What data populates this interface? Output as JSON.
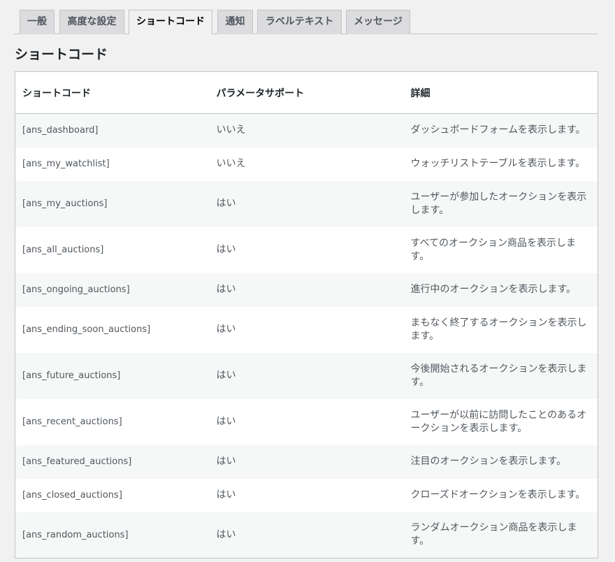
{
  "tabs": [
    {
      "label": "一般",
      "active": false
    },
    {
      "label": "高度な設定",
      "active": false
    },
    {
      "label": "ショートコード",
      "active": true
    },
    {
      "label": "通知",
      "active": false
    },
    {
      "label": "ラベルテキスト",
      "active": false
    },
    {
      "label": "メッセージ",
      "active": false
    }
  ],
  "section_title": "ショートコード",
  "table": {
    "headers": [
      "ショートコード",
      "パラメータサポート",
      "詳細"
    ],
    "rows": [
      {
        "code": "[ans_dashboard]",
        "param": "いいえ",
        "desc": "ダッシュボードフォームを表示します。"
      },
      {
        "code": "[ans_my_watchlist]",
        "param": "いいえ",
        "desc": "ウォッチリストテーブルを表示します。"
      },
      {
        "code": "[ans_my_auctions]",
        "param": "はい",
        "desc": "ユーザーが参加したオークションを表示します。"
      },
      {
        "code": "[ans_all_auctions]",
        "param": "はい",
        "desc": "すべてのオークション商品を表示します。"
      },
      {
        "code": "[ans_ongoing_auctions]",
        "param": "はい",
        "desc": "進行中のオークションを表示します。"
      },
      {
        "code": "[ans_ending_soon_auctions]",
        "param": "はい",
        "desc": "まもなく終了するオークションを表示します。"
      },
      {
        "code": "[ans_future_auctions]",
        "param": "はい",
        "desc": "今後開始されるオークションを表示します。"
      },
      {
        "code": "[ans_recent_auctions]",
        "param": "はい",
        "desc": "ユーザーが以前に訪問したことのあるオークションを表示します。"
      },
      {
        "code": "[ans_featured_auctions]",
        "param": "はい",
        "desc": "注目のオークションを表示します。"
      },
      {
        "code": "[ans_closed_auctions]",
        "param": "はい",
        "desc": "クローズドオークションを表示します。"
      },
      {
        "code": "[ans_random_auctions]",
        "param": "はい",
        "desc": "ランダムオークション商品を表示します。"
      }
    ]
  },
  "colors": {
    "background": "#f1f1f1",
    "tab_inactive": "#dcdcde",
    "border": "#c3c4c7",
    "row_alt": "#f6f7f7"
  }
}
